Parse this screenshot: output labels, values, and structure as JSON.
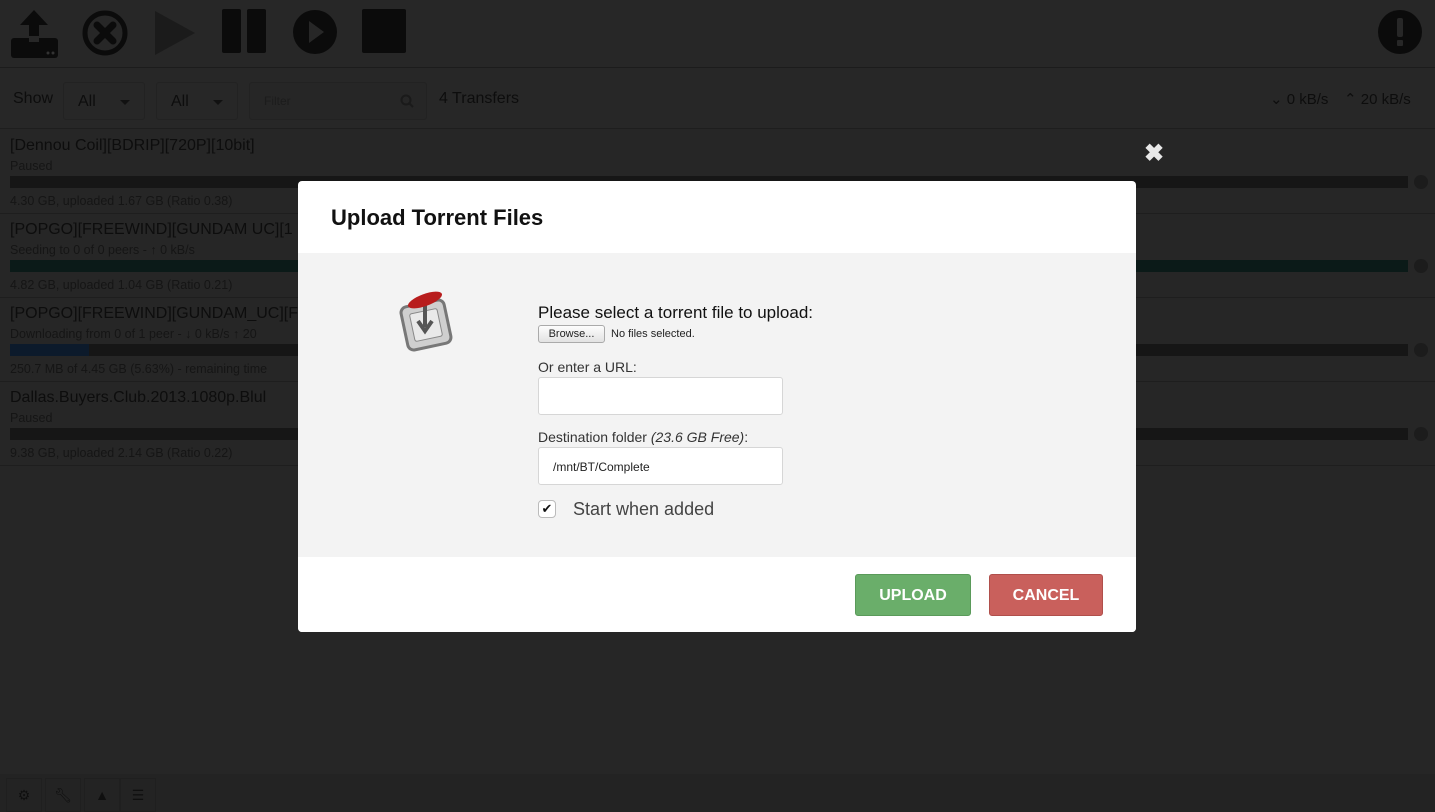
{
  "toolbar": {
    "icons": [
      "upload-icon",
      "remove-icon",
      "start-icon",
      "pause-icon",
      "start-all-icon",
      "stop-all-icon",
      "inspector-icon"
    ]
  },
  "filterbar": {
    "show_label": "Show",
    "state_filter": "All",
    "tracker_filter": "All",
    "filter_placeholder": "Filter",
    "transfer_count": "4 Transfers",
    "download_speed": "0 kB/s",
    "upload_speed": "20 kB/s"
  },
  "torrents": [
    {
      "name": "[Dennou Coil][BDRIP][720P][10bit]",
      "status": "Paused",
      "detail": "4.30 GB, uploaded 1.67 GB (Ratio 0.38)",
      "progress": 100,
      "bar_color": "#161616"
    },
    {
      "name": "[POPGO][FREEWIND][GUNDAM UC][1",
      "status": "Seeding to 0 of 0 peers - ↑ 0 kB/s",
      "detail": "4.82 GB, uploaded 1.04 GB (Ratio 0.21)",
      "progress": 100,
      "bar_color": "#0b1a18"
    },
    {
      "name": "[POPGO][FREEWIND][GUNDAM_UC][F",
      "status": "Downloading from 0 of 1 peer - ↓ 0 kB/s ↑ 20",
      "detail": "250.7 MB of 4.45 GB (5.63%) - remaining time",
      "progress": 5.63,
      "bar_color": "#0c1a2b"
    },
    {
      "name": "Dallas.Buyers.Club.2013.1080p.Blul",
      "status": "Paused",
      "detail": "9.38 GB, uploaded 2.14 GB (Ratio 0.22)",
      "progress": 100,
      "bar_color": "#161616"
    }
  ],
  "dialog": {
    "title": "Upload Torrent Files",
    "select_label": "Please select a torrent file to upload:",
    "browse_label": "Browse...",
    "no_files": "No files selected.",
    "url_label": "Or enter a URL:",
    "url_value": "",
    "dest_label": "Destination folder",
    "dest_free": "(23.6 GB Free)",
    "dest_colon": ":",
    "dest_value": "/mnt/BT/Complete",
    "start_label": "Start when added",
    "start_checked": true,
    "upload_label": "UPLOAD",
    "cancel_label": "CANCEL",
    "upload_color": "#6aae6a",
    "cancel_color": "#c9605c"
  },
  "footer": {
    "icons": [
      "gear-icon",
      "wrench-icon",
      "turtle-icon",
      "list-icon"
    ]
  }
}
